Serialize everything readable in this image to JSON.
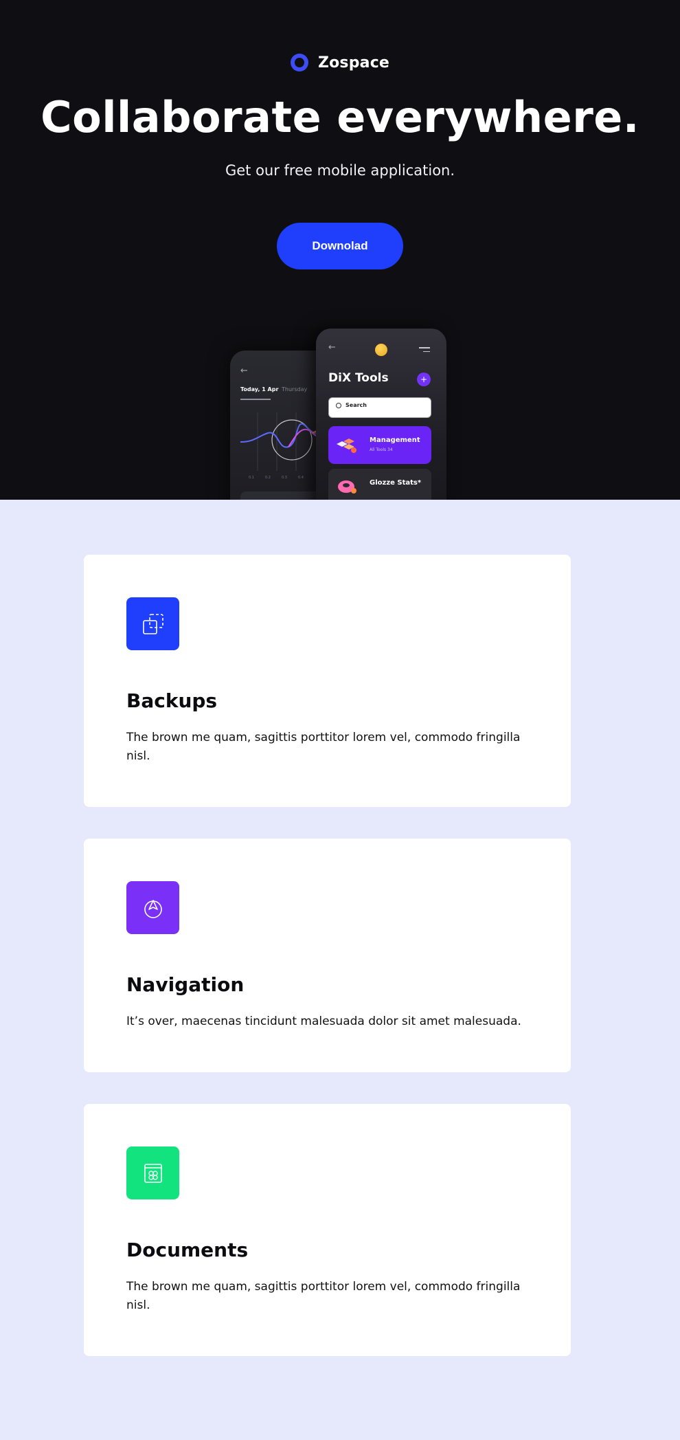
{
  "brand": {
    "name": "Zospace",
    "accent": "#3d4cf5"
  },
  "hero": {
    "title": "Collaborate everywhere.",
    "subtitle": "Get our free mobile application.",
    "download_label": "Downolad",
    "button_color": "#1f3ffd"
  },
  "phone_back": {
    "tab_active": "Today, 1 Apr",
    "tab_inactive": "Thursday",
    "ticks": [
      "0.1",
      "0.2",
      "0.3",
      "0.4"
    ]
  },
  "phone_front": {
    "title": "DiX Tools",
    "search_placeholder": "Search",
    "cards": [
      {
        "title": "Management",
        "subtitle": "All Tools 34"
      },
      {
        "title": "Glozze Stats*",
        "subtitle": ""
      }
    ]
  },
  "features": [
    {
      "icon": "backup-icon",
      "color": "#1f3ffd",
      "title": "Backups",
      "description": "The brown me quam, sagittis porttitor lorem vel, commodo fringilla nisl."
    },
    {
      "icon": "compass-icon",
      "color": "#7a30f7",
      "title": "Navigation",
      "description": "It’s over, maecenas tincidunt malesuada dolor sit amet malesuada."
    },
    {
      "icon": "document-icon",
      "color": "#12e37f",
      "title": "Documents",
      "description": "The brown me quam, sagittis porttitor lorem vel, commodo fringilla nisl."
    }
  ]
}
